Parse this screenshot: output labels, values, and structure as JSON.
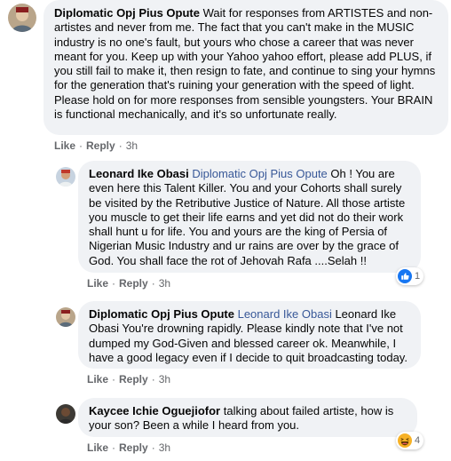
{
  "comments": [
    {
      "author": "Diplomatic Opj Pius Opute",
      "mention": "",
      "text": "Wait for responses from ARTISTES and non-artistes and never from me. The fact that you can't make in the MUSIC industry is no one's fault, but yours who chose a career that was never meant for you. Keep up with your Yahoo yahoo effort, please add PLUS, if you still fail to make it, then resign to fate, and continue to sing your hymns for the generation that's ruining your generation with the speed of light. Please hold on for more responses from sensible youngsters. Your BRAIN is functional mechanically, and it's so unfortunate really.",
      "like": "Like",
      "reply": "Reply",
      "time": "3h"
    },
    {
      "author": "Leonard Ike Obasi",
      "mention": "Diplomatic Opj Pius Opute",
      "text": "Oh ! You are even here this Talent Killer. You and your Cohorts shall surely be visited by the Retributive Justice of Nature. All those artiste you muscle to get their life earns and yet did not do their work shall hunt u for life. You and yours are the king of Persia of Nigerian Music Industry and ur rains are over by the grace of God. You shall face the rot of Jehovah Rafa ....Selah !!",
      "like": "Like",
      "reply": "Reply",
      "time": "3h",
      "reaction_count": "1",
      "reaction_icon": "like-reaction-icon",
      "reaction_color": "#1877f2"
    },
    {
      "author": "Diplomatic Opj Pius Opute",
      "mention": "Leonard Ike Obasi",
      "text": "Leonard Ike Obasi You're drowning rapidly. Please kindly note that I've not dumped my God-Given and blessed career ok. Meanwhile, I have a good legacy even if I decide to quit broadcasting today.",
      "like": "Like",
      "reply": "Reply",
      "time": "3h"
    },
    {
      "author": "Kaycee Ichie Oguejiofor",
      "mention": "",
      "text": "talking about failed artiste, how is your son? Been a while I heard from you.",
      "like": "Like",
      "reply": "Reply",
      "time": "3h",
      "reaction_count": "4",
      "reaction_icon": "haha-reaction-icon",
      "reaction_color": "#f7b125"
    }
  ],
  "separator": "·",
  "colors": {
    "bubble": "#f0f2f5",
    "mention": "#385898",
    "meta": "#65676b"
  }
}
